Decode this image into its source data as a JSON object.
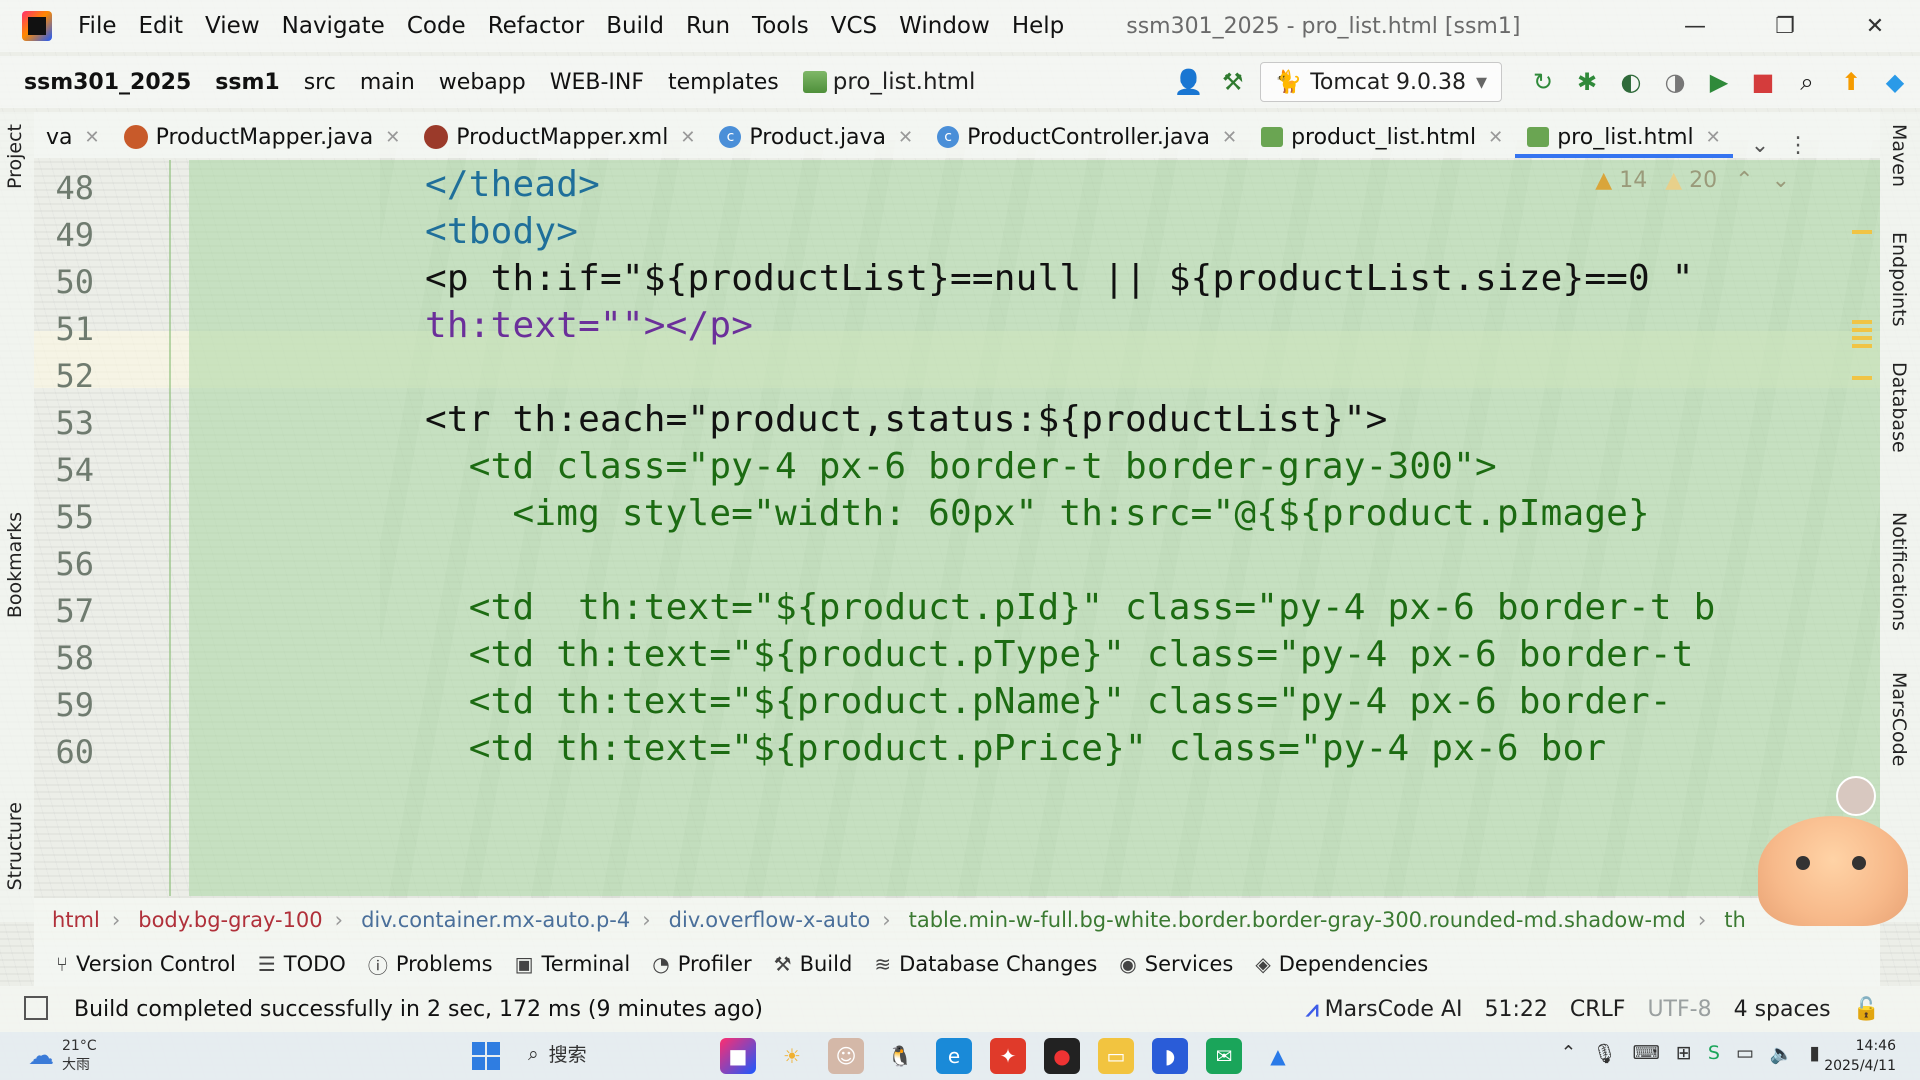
{
  "menu": {
    "items": [
      "File",
      "Edit",
      "View",
      "Navigate",
      "Code",
      "Refactor",
      "Build",
      "Run",
      "Tools",
      "VCS",
      "Window",
      "Help"
    ],
    "window_title": "ssm301_2025 - pro_list.html [ssm1]"
  },
  "window_controls": {
    "minimize": "—",
    "restore": "❐",
    "close": "✕"
  },
  "breadcrumb": [
    "ssm301_2025",
    "ssm1",
    "src",
    "main",
    "webapp",
    "WEB-INF",
    "templates"
  ],
  "breadcrumb_file": "pro_list.html",
  "run_config": "Tomcat 9.0.38",
  "tabs": [
    {
      "label": "va",
      "icon": "none"
    },
    {
      "label": "ProductMapper.java",
      "icon": "java"
    },
    {
      "label": "ProductMapper.xml",
      "icon": "xml"
    },
    {
      "label": "Product.java",
      "icon": "class"
    },
    {
      "label": "ProductController.java",
      "icon": "class"
    },
    {
      "label": "product_list.html",
      "icon": "html"
    },
    {
      "label": "pro_list.html",
      "icon": "html",
      "active": true
    }
  ],
  "inspection": {
    "warnings": "14",
    "weak_warnings": "20"
  },
  "code_lines": [
    {
      "n": "48",
      "text": "</thead>"
    },
    {
      "n": "49",
      "text": "<tbody>"
    },
    {
      "n": "50",
      "text": "<p th:if=\"${productList}==null || ${productList.size}==0 \""
    },
    {
      "n": "51",
      "text": "th:text=\"\"></p>"
    },
    {
      "n": "52",
      "text": ""
    },
    {
      "n": "53",
      "text": "<tr th:each=\"product,status:${productList}\">"
    },
    {
      "n": "54",
      "text": "  <td class=\"py-4 px-6 border-t border-gray-300\">"
    },
    {
      "n": "55",
      "text": "    <img style=\"width: 60px\" th:src=\"@{${product.pImage}"
    },
    {
      "n": "56",
      "text": ""
    },
    {
      "n": "57",
      "text": "  <td  th:text=\"${product.pId}\" class=\"py-4 px-6 border-t b"
    },
    {
      "n": "58",
      "text": "  <td th:text=\"${product.pType}\" class=\"py-4 px-6 border-t"
    },
    {
      "n": "59",
      "text": "  <td th:text=\"${product.pName}\" class=\"py-4 px-6 border-"
    },
    {
      "n": "60",
      "text": "  <td th:text=\"${product.pPrice}\" class=\"py-4 px-6 bor"
    }
  ],
  "structure_path": [
    "html",
    "body.bg-gray-100",
    "div.container.mx-auto.p-4",
    "div.overflow-x-auto",
    "table.min-w-full.bg-white.border.border-gray-300.rounded-md.shadow-md",
    "th"
  ],
  "left_tools": [
    "Project",
    "Bookmarks",
    "Structure"
  ],
  "right_tools": [
    "Maven",
    "Endpoints",
    "Database",
    "Notifications",
    "MarsCode"
  ],
  "tool_windows": [
    {
      "label": "Version Control",
      "icon": "branch-icon"
    },
    {
      "label": "TODO",
      "icon": "list-icon"
    },
    {
      "label": "Problems",
      "icon": "problems-icon"
    },
    {
      "label": "Terminal",
      "icon": "terminal-icon"
    },
    {
      "label": "Profiler",
      "icon": "profiler-icon"
    },
    {
      "label": "Build",
      "icon": "hammer-icon"
    },
    {
      "label": "Database Changes",
      "icon": "database-changes-icon"
    },
    {
      "label": "Services",
      "icon": "services-icon"
    },
    {
      "label": "Dependencies",
      "icon": "dependencies-icon"
    }
  ],
  "status": {
    "message": "Build completed successfully in 2 sec, 172 ms (9 minutes ago)",
    "plugin": "MarsCode AI",
    "position": "51:22",
    "line_sep": "CRLF",
    "encoding": "UTF-8",
    "indent": "4 spaces"
  },
  "taskbar": {
    "temp": "21°C",
    "weather": "大雨",
    "search_placeholder": "搜索",
    "time": "14:46",
    "date": "2025/4/11"
  }
}
